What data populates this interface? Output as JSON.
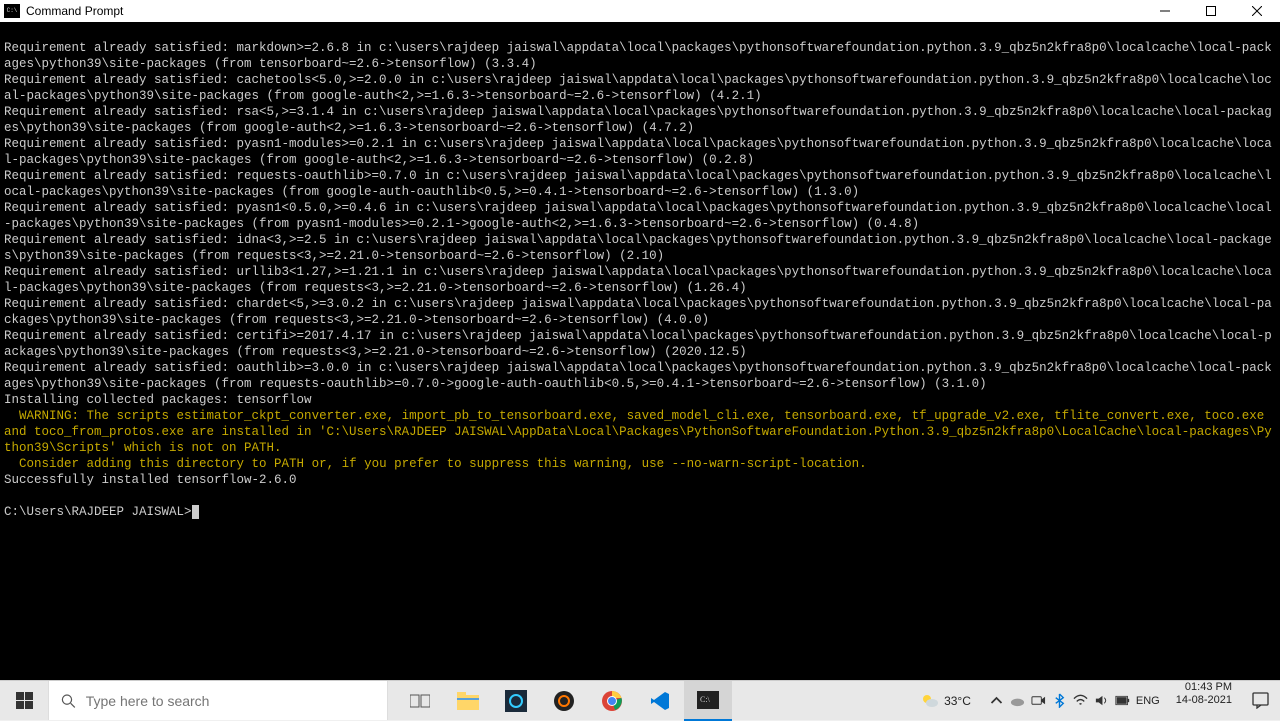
{
  "window": {
    "title": "Command Prompt"
  },
  "terminal": {
    "lines": [
      "Requirement already satisfied: markdown>=2.6.8 in c:\\users\\rajdeep jaiswal\\appdata\\local\\packages\\pythonsoftwarefoundation.python.3.9_qbz5n2kfra8p0\\localcache\\local-packages\\python39\\site-packages (from tensorboard~=2.6->tensorflow) (3.3.4)",
      "Requirement already satisfied: cachetools<5.0,>=2.0.0 in c:\\users\\rajdeep jaiswal\\appdata\\local\\packages\\pythonsoftwarefoundation.python.3.9_qbz5n2kfra8p0\\localcache\\local-packages\\python39\\site-packages (from google-auth<2,>=1.6.3->tensorboard~=2.6->tensorflow) (4.2.1)",
      "Requirement already satisfied: rsa<5,>=3.1.4 in c:\\users\\rajdeep jaiswal\\appdata\\local\\packages\\pythonsoftwarefoundation.python.3.9_qbz5n2kfra8p0\\localcache\\local-packages\\python39\\site-packages (from google-auth<2,>=1.6.3->tensorboard~=2.6->tensorflow) (4.7.2)",
      "Requirement already satisfied: pyasn1-modules>=0.2.1 in c:\\users\\rajdeep jaiswal\\appdata\\local\\packages\\pythonsoftwarefoundation.python.3.9_qbz5n2kfra8p0\\localcache\\local-packages\\python39\\site-packages (from google-auth<2,>=1.6.3->tensorboard~=2.6->tensorflow) (0.2.8)",
      "Requirement already satisfied: requests-oauthlib>=0.7.0 in c:\\users\\rajdeep jaiswal\\appdata\\local\\packages\\pythonsoftwarefoundation.python.3.9_qbz5n2kfra8p0\\localcache\\local-packages\\python39\\site-packages (from google-auth-oauthlib<0.5,>=0.4.1->tensorboard~=2.6->tensorflow) (1.3.0)",
      "Requirement already satisfied: pyasn1<0.5.0,>=0.4.6 in c:\\users\\rajdeep jaiswal\\appdata\\local\\packages\\pythonsoftwarefoundation.python.3.9_qbz5n2kfra8p0\\localcache\\local-packages\\python39\\site-packages (from pyasn1-modules>=0.2.1->google-auth<2,>=1.6.3->tensorboard~=2.6->tensorflow) (0.4.8)",
      "Requirement already satisfied: idna<3,>=2.5 in c:\\users\\rajdeep jaiswal\\appdata\\local\\packages\\pythonsoftwarefoundation.python.3.9_qbz5n2kfra8p0\\localcache\\local-packages\\python39\\site-packages (from requests<3,>=2.21.0->tensorboard~=2.6->tensorflow) (2.10)",
      "Requirement already satisfied: urllib3<1.27,>=1.21.1 in c:\\users\\rajdeep jaiswal\\appdata\\local\\packages\\pythonsoftwarefoundation.python.3.9_qbz5n2kfra8p0\\localcache\\local-packages\\python39\\site-packages (from requests<3,>=2.21.0->tensorboard~=2.6->tensorflow) (1.26.4)",
      "Requirement already satisfied: chardet<5,>=3.0.2 in c:\\users\\rajdeep jaiswal\\appdata\\local\\packages\\pythonsoftwarefoundation.python.3.9_qbz5n2kfra8p0\\localcache\\local-packages\\python39\\site-packages (from requests<3,>=2.21.0->tensorboard~=2.6->tensorflow) (4.0.0)",
      "Requirement already satisfied: certifi>=2017.4.17 in c:\\users\\rajdeep jaiswal\\appdata\\local\\packages\\pythonsoftwarefoundation.python.3.9_qbz5n2kfra8p0\\localcache\\local-packages\\python39\\site-packages (from requests<3,>=2.21.0->tensorboard~=2.6->tensorflow) (2020.12.5)",
      "Requirement already satisfied: oauthlib>=3.0.0 in c:\\users\\rajdeep jaiswal\\appdata\\local\\packages\\pythonsoftwarefoundation.python.3.9_qbz5n2kfra8p0\\localcache\\local-packages\\python39\\site-packages (from requests-oauthlib>=0.7.0->google-auth-oauthlib<0.5,>=0.4.1->tensorboard~=2.6->tensorflow) (3.1.0)",
      "Installing collected packages: tensorflow"
    ],
    "warning": [
      "  WARNING: The scripts estimator_ckpt_converter.exe, import_pb_to_tensorboard.exe, saved_model_cli.exe, tensorboard.exe, tf_upgrade_v2.exe, tflite_convert.exe, toco.exe and toco_from_protos.exe are installed in 'C:\\Users\\RAJDEEP JAISWAL\\AppData\\Local\\Packages\\PythonSoftwareFoundation.Python.3.9_qbz5n2kfra8p0\\LocalCache\\local-packages\\Python39\\Scripts' which is not on PATH.",
      "  Consider adding this directory to PATH or, if you prefer to suppress this warning, use --no-warn-script-location."
    ],
    "success": "Successfully installed tensorflow-2.6.0",
    "blank": "",
    "prompt": "C:\\Users\\RAJDEEP JAISWAL>"
  },
  "taskbar": {
    "search_placeholder": "Type here to search",
    "weather_temp": "33°C",
    "time": "01:43 PM",
    "date": "14-08-2021"
  }
}
